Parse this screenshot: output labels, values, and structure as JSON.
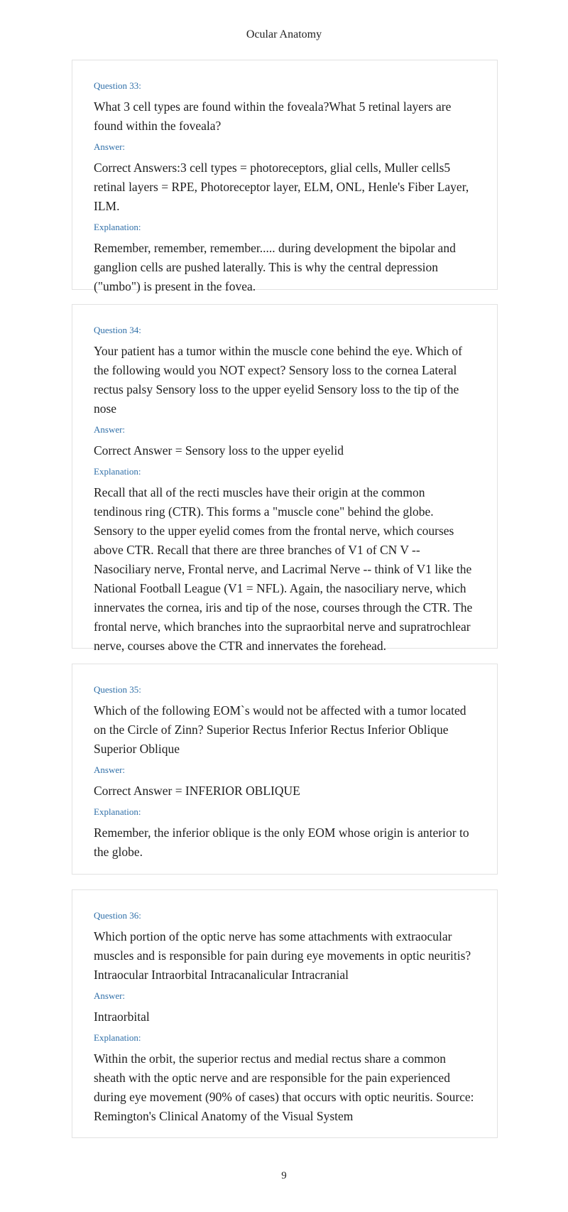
{
  "page_title": "Ocular Anatomy",
  "page_number": "9",
  "labels": {
    "answer": "Answer:",
    "explanation": "Explanation:"
  },
  "questions": [
    {
      "label": "Question 33:",
      "question": "What 3 cell types are found within the foveala?What 5 retinal layers are found within the foveala?",
      "answer": "Correct Answers:3 cell types = photoreceptors, glial cells, Muller cells5 retinal layers = RPE, Photoreceptor layer, ELM, ONL, Henle's Fiber Layer, ILM.",
      "explanation": "Remember, remember, remember..... during development the bipolar and ganglion cells are pushed laterally. This is why the central depression (\"umbo\") is present in the fovea."
    },
    {
      "label": "Question 34:",
      "question": "Your patient has a tumor within the muscle cone behind the eye. Which of the following would you NOT expect? Sensory loss to the cornea Lateral rectus palsy Sensory loss to the upper eyelid Sensory loss to the tip of the nose",
      "answer": "Correct Answer = Sensory loss to the upper eyelid",
      "explanation": "Recall that all of the recti muscles have their origin at the common tendinous ring (CTR). This forms a \"muscle cone\" behind the globe. Sensory to the upper eyelid comes from the frontal nerve, which courses above CTR. Recall that there are three branches of V1 of CN V -- Nasociliary nerve, Frontal nerve, and Lacrimal Nerve -- think of V1 like the National Football League (V1 = NFL). Again, the nasociliary nerve, which innervates the cornea, iris and tip of the nose, courses through the CTR. The frontal nerve, which branches into the supraorbital nerve and supratrochlear nerve, courses above the CTR and innervates the forehead."
    },
    {
      "label": "Question 35:",
      "question": "Which of the following EOM`s would not be affected with a tumor located on the Circle of Zinn? Superior Rectus Inferior Rectus Inferior Oblique Superior Oblique",
      "answer": "Correct Answer = INFERIOR OBLIQUE",
      "explanation": "Remember, the inferior oblique is the only EOM whose origin is anterior to the globe."
    },
    {
      "label": "Question 36:",
      "question": "Which portion of the optic nerve has some attachments with extraocular muscles and is responsible for pain during eye movements in optic neuritis? Intraocular Intraorbital Intracanalicular Intracranial",
      "answer": "Intraorbital",
      "explanation": "Within the orbit, the superior rectus and medial rectus share a common sheath with the optic nerve and are responsible for the pain experienced during eye movement (90% of cases) that occurs with optic neuritis. Source: Remington's Clinical Anatomy of the Visual System"
    }
  ]
}
